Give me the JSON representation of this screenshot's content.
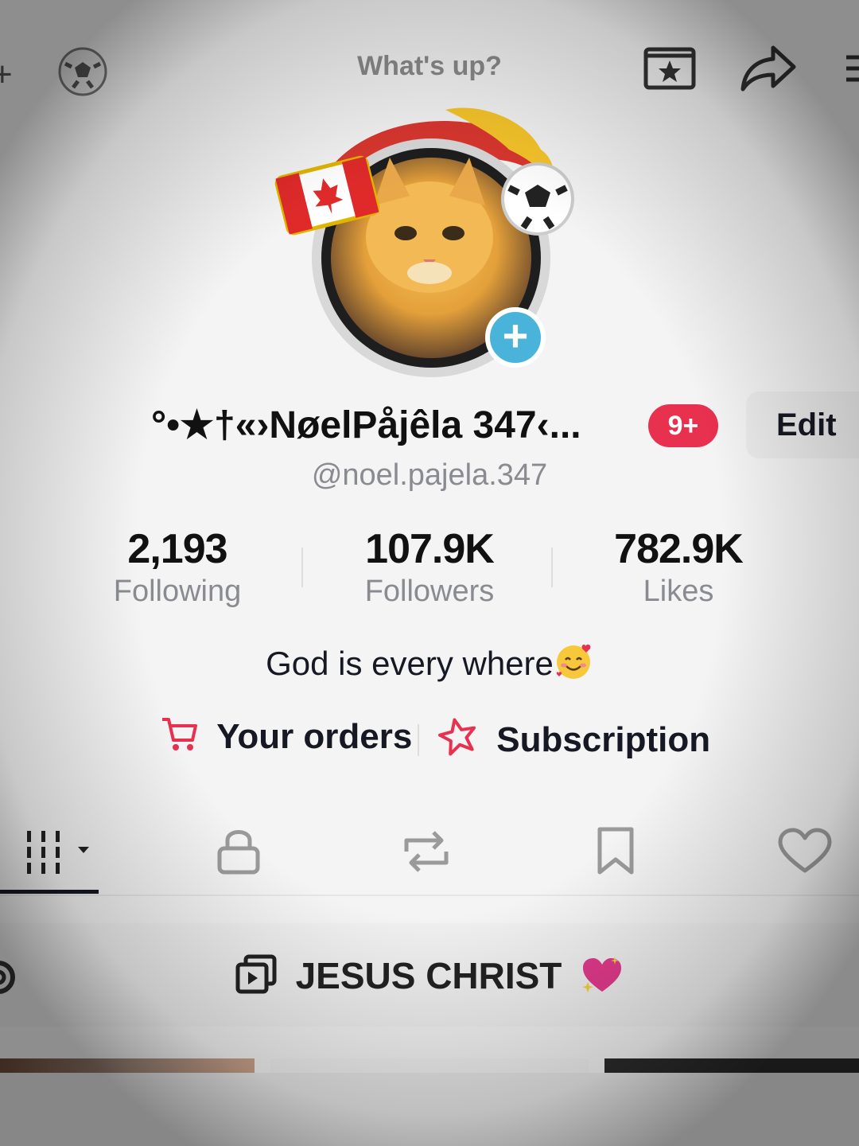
{
  "header": {
    "title": "What's up?",
    "add_symbol": "+"
  },
  "profile": {
    "display_name": "°•★†«›NøelPåjêla 347‹...",
    "notification_badge": "9+",
    "edit_label": "Edit",
    "handle": "@noel.pajela.347",
    "add_symbol": "+"
  },
  "stats": [
    {
      "value": "2,193",
      "label": "Following"
    },
    {
      "value": "107.9K",
      "label": "Followers"
    },
    {
      "value": "782.9K",
      "label": "Likes"
    }
  ],
  "bio": {
    "text": "God is every where",
    "emoji_icon": "smiling-face-with-hearts-icon"
  },
  "links": {
    "orders_label": "Your orders",
    "subscription_label": "Subscription"
  },
  "tabs": [
    {
      "icon": "grid-icon",
      "active": true
    },
    {
      "icon": "lock-icon",
      "active": false
    },
    {
      "icon": "repost-icon",
      "active": false
    },
    {
      "icon": "bookmark-icon",
      "active": false
    },
    {
      "icon": "heart-icon",
      "active": false
    }
  ],
  "playlist": {
    "title": "JESUS CHRIST"
  },
  "colors": {
    "accent_red": "#e8304f",
    "badge_blue": "#4ab3d9",
    "text_primary": "#161823",
    "text_secondary": "#8a8b91"
  }
}
